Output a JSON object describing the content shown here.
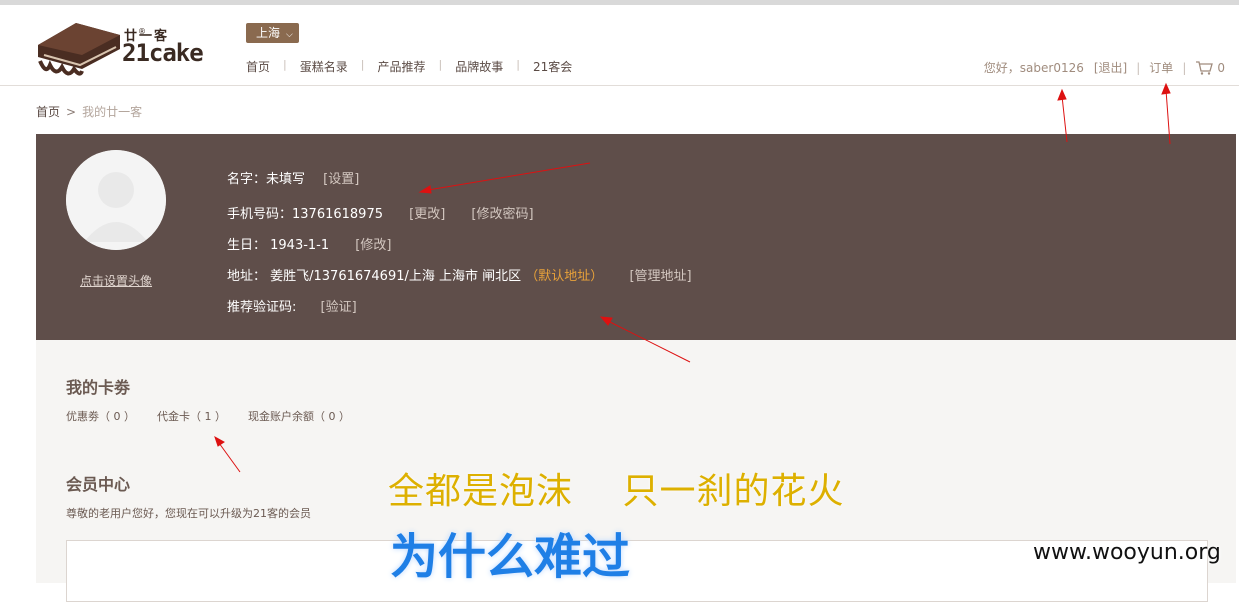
{
  "header": {
    "logo_cn": "廿一客",
    "logo_en": "21cake",
    "logo_reg": "®",
    "city": "上海",
    "nav": [
      "首页",
      "蛋糕名录",
      "产品推荐",
      "品牌故事",
      "21客会"
    ],
    "user": {
      "greeting": "您好，saber0126",
      "logout": "[退出]",
      "orders": "订单",
      "cart_count": "0"
    }
  },
  "breadcrumb": {
    "home": "首页",
    "sep": ">",
    "current": "我的廿一客"
  },
  "profile": {
    "avatar_link": "点击设置头像",
    "name_label": "名字：未填写",
    "name_action": "[设置]",
    "phone_label": "手机号码：13761618975",
    "phone_change": "[更改]",
    "password_change": "[修改密码]",
    "birthday_label": "生日： 1943-1-1",
    "birthday_action": "[修改]",
    "address_label": "地址： 姜胜飞/13761674691/上海 上海市 闸北区",
    "address_default": "（默认地址）",
    "address_manage": "[管理地址]",
    "referral_label": "推荐验证码:",
    "referral_action": "[验证]"
  },
  "cards": {
    "title": "我的卡劵",
    "coupon": "优惠劵（ 0 ）",
    "voucher": "代金卡（ 1 ）",
    "balance": "现金账户余额（ 0 ）"
  },
  "member": {
    "title": "会员中心",
    "desc": "尊敬的老用户您好，您现在可以升级为21客的会员"
  },
  "overlay": {
    "line1": "全都是泡沫　 只一刹的花火",
    "line2": "为什么难过",
    "watermark": "www.wooyun.org"
  },
  "colors": {
    "profile_bg": "#5f4e4a",
    "content_bg": "#f6f5f3",
    "highlight": "#e8a23a",
    "annotation_red": "#dd1111",
    "overlay_yellow": "#ddb000",
    "overlay_blue": "#1f7fe6"
  }
}
